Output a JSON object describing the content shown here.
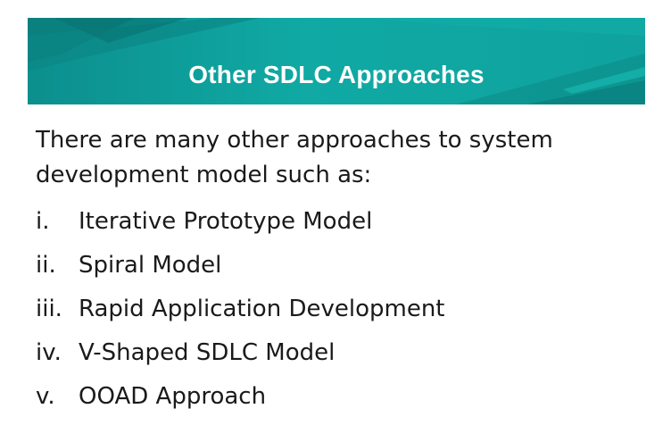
{
  "slide": {
    "title": "Other SDLC Approaches",
    "intro": "There are many other approaches to system development model such as:",
    "items": [
      {
        "marker": "i.",
        "text": "Iterative Prototype Model"
      },
      {
        "marker": "ii.",
        "text": "Spiral Model"
      },
      {
        "marker": "iii.",
        "text": "Rapid Application Development"
      },
      {
        "marker": "iv.",
        "text": "V-Shaped SDLC Model"
      },
      {
        "marker": "v.",
        "text": "OOAD Approach"
      }
    ]
  },
  "colors": {
    "banner_teal": "#10a9a4",
    "banner_dark": "#0c8f8d",
    "text": "#1a1a1a",
    "title_text": "#ffffff"
  }
}
